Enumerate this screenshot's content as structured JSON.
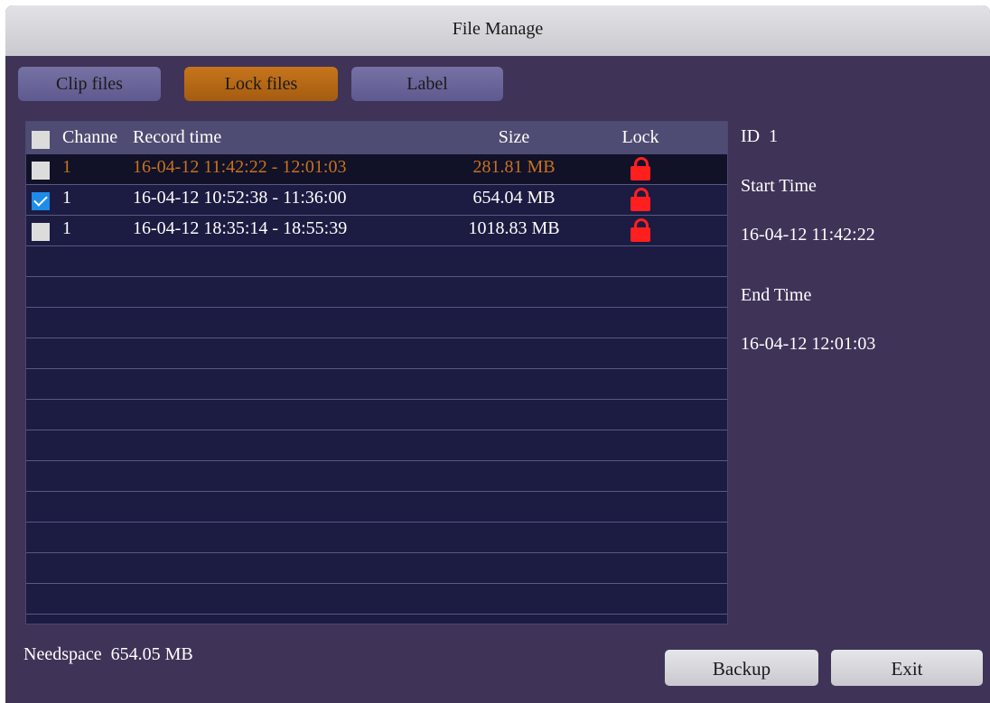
{
  "window": {
    "title": "File Manage"
  },
  "tabs": [
    {
      "label": "Clip files",
      "active": false
    },
    {
      "label": "Lock files",
      "active": true
    },
    {
      "label": "Label",
      "active": false
    }
  ],
  "table": {
    "headers": {
      "channel": "Channe",
      "record_time": "Record time",
      "size": "Size",
      "lock": "Lock"
    },
    "rows": [
      {
        "channel": "1",
        "record_time": "16-04-12 11:42:22 - 12:01:03",
        "size": "281.81 MB",
        "locked": true,
        "checked": false,
        "selected": true
      },
      {
        "channel": "1",
        "record_time": "16-04-12 10:52:38 - 11:36:00",
        "size": "654.04 MB",
        "locked": true,
        "checked": true,
        "selected": false
      },
      {
        "channel": "1",
        "record_time": "16-04-12 18:35:14 - 18:55:39",
        "size": "1018.83 MB",
        "locked": true,
        "checked": false,
        "selected": false
      }
    ],
    "empty_row_count": 12
  },
  "details": {
    "id_label": "ID",
    "id_value": "1",
    "start_label": "Start Time",
    "start_value": "16-04-12 11:42:22",
    "end_label": "End Time",
    "end_value": "16-04-12 12:01:03"
  },
  "footer": {
    "needspace_label": "Needspace",
    "needspace_value": "654.05 MB",
    "backup_label": "Backup",
    "exit_label": "Exit"
  },
  "colors": {
    "background": "#403358",
    "active_tab": "#b6661a",
    "selected_text": "#c8721d",
    "lock_icon": "#ff1f1f",
    "check": "#1e8ce8"
  },
  "icons": {
    "lock": "lock-icon",
    "checkbox": "checkbox"
  }
}
